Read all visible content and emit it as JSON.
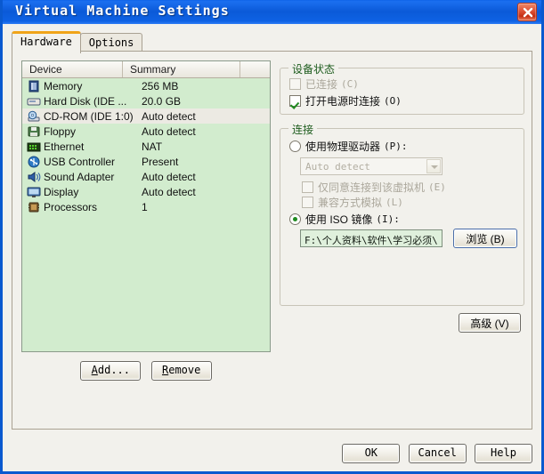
{
  "window": {
    "title": "Virtual Machine Settings",
    "close_label": "×",
    "accent_titlebar": "#0b5ad8",
    "dialog_bg": "#f2f1ec",
    "list_bg": "#d2ecce"
  },
  "tabs": [
    {
      "label": "Hardware",
      "selected": true
    },
    {
      "label": "Options",
      "selected": false
    }
  ],
  "device_list": {
    "columns": [
      "Device",
      "Summary",
      ""
    ],
    "rows": [
      {
        "icon": "memory-icon",
        "device": "Memory",
        "summary": "256 MB",
        "selected": false
      },
      {
        "icon": "hard-disk-icon",
        "device": "Hard Disk (IDE ...",
        "summary": "20.0 GB",
        "selected": false
      },
      {
        "icon": "cd-rom-icon",
        "device": "CD-ROM (IDE 1:0)",
        "summary": "Auto detect",
        "selected": true
      },
      {
        "icon": "floppy-icon",
        "device": "Floppy",
        "summary": "Auto detect",
        "selected": false
      },
      {
        "icon": "ethernet-icon",
        "device": "Ethernet",
        "summary": "NAT",
        "selected": false
      },
      {
        "icon": "usb-controller-icon",
        "device": "USB Controller",
        "summary": "Present",
        "selected": false
      },
      {
        "icon": "sound-adapter-icon",
        "device": "Sound Adapter",
        "summary": "Auto detect",
        "selected": false
      },
      {
        "icon": "display-icon",
        "device": "Display",
        "summary": "Auto detect",
        "selected": false
      },
      {
        "icon": "processors-icon",
        "device": "Processors",
        "summary": "1",
        "selected": false
      }
    ],
    "add_label": "Add...",
    "add_mnemonic": "A",
    "remove_label": "Remove",
    "remove_mnemonic": "R"
  },
  "device_status": {
    "group_label": "设备状态",
    "connected": {
      "label": "已连接",
      "mnemonic": "(C)",
      "checked": false,
      "disabled": true
    },
    "connect_at_power_on": {
      "label": "打开电源时连接",
      "mnemonic": "(O)",
      "checked": true,
      "disabled": false
    }
  },
  "connection": {
    "group_label": "连接",
    "use_physical_drive": {
      "label": "使用物理驱动器",
      "mnemonic": "(P):",
      "selected": false
    },
    "drive_combo": {
      "value": "Auto detect",
      "disabled": true
    },
    "exclusive": {
      "label": "仅同意连接到该虚拟机",
      "mnemonic": "(E)",
      "checked": false,
      "disabled": true
    },
    "legacy_emulation": {
      "label": "兼容方式模拟",
      "mnemonic": "(L)",
      "checked": false,
      "disabled": true
    },
    "use_iso_image": {
      "label": "使用 ISO 镜像",
      "mnemonic": "(I):",
      "selected": true
    },
    "iso_path": "F:\\个人资料\\软件\\学习必须\\",
    "browse_label": "浏览 (B)"
  },
  "advanced": {
    "label": "高级 (V)"
  },
  "footer": {
    "ok_label": "OK",
    "cancel_label": "Cancel",
    "help_label": "Help"
  }
}
